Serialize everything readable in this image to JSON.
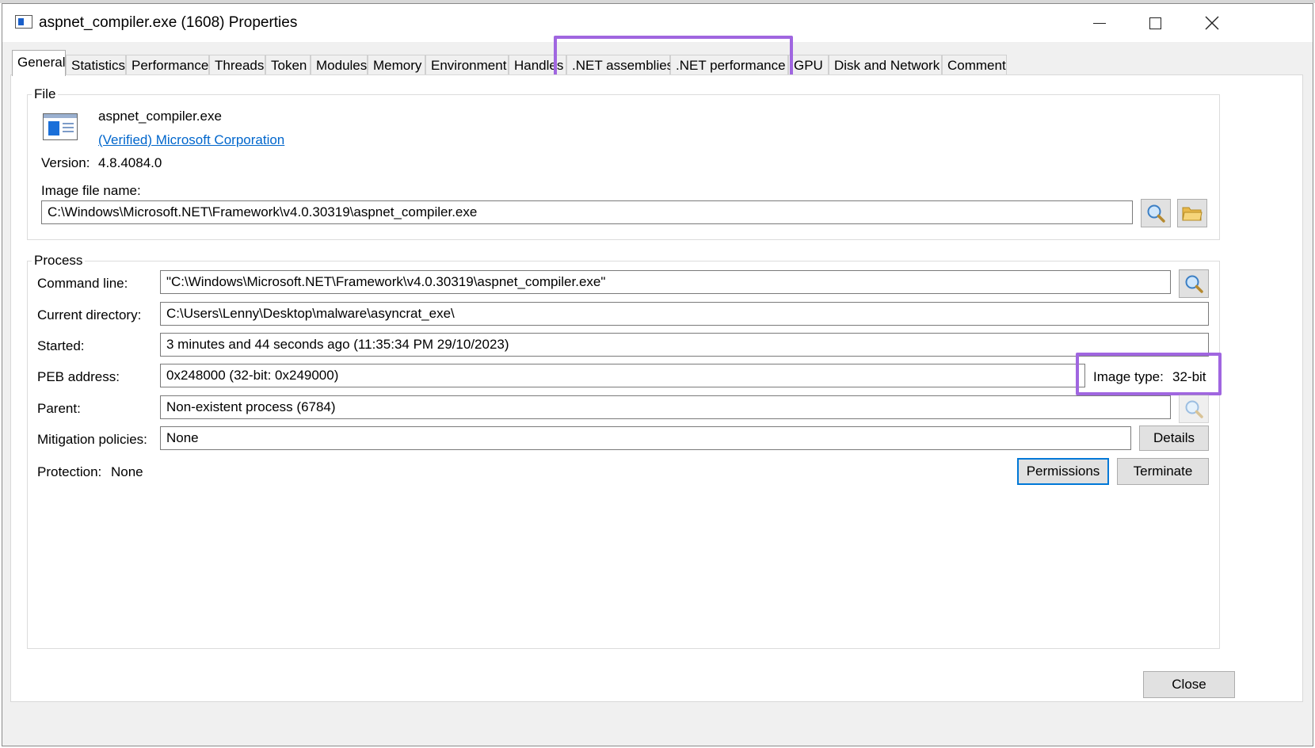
{
  "window": {
    "title": "aspnet_compiler.exe (1608) Properties",
    "controls": {
      "minimize": "—",
      "maximize": "☐",
      "close": "✕"
    }
  },
  "tabs": [
    {
      "label": "General",
      "active": true
    },
    {
      "label": "Statistics"
    },
    {
      "label": "Performance"
    },
    {
      "label": "Threads"
    },
    {
      "label": "Token"
    },
    {
      "label": "Modules"
    },
    {
      "label": "Memory"
    },
    {
      "label": "Environment"
    },
    {
      "label": "Handles"
    },
    {
      "label": ".NET assemblies"
    },
    {
      "label": ".NET performance"
    },
    {
      "label": "GPU"
    },
    {
      "label": "Disk and Network"
    },
    {
      "label": "Comment"
    }
  ],
  "file": {
    "legend": "File",
    "name": "aspnet_compiler.exe",
    "publisher": "(Verified) Microsoft Corporation",
    "version_label": "Version:",
    "version": "4.8.4084.0",
    "image_file_name_label": "Image file name:",
    "image_file_name": "C:\\Windows\\Microsoft.NET\\Framework\\v4.0.30319\\aspnet_compiler.exe"
  },
  "process": {
    "legend": "Process",
    "command_line_label": "Command line:",
    "command_line": "\"C:\\Windows\\Microsoft.NET\\Framework\\v4.0.30319\\aspnet_compiler.exe\"",
    "current_directory_label": "Current directory:",
    "current_directory": "C:\\Users\\Lenny\\Desktop\\malware\\asyncrat_exe\\",
    "started_label": "Started:",
    "started": "3 minutes and 44 seconds ago (11:35:34 PM 29/10/2023)",
    "peb_label": "PEB address:",
    "peb": "0x248000 (32-bit: 0x249000)",
    "image_type_label": "Image type:",
    "image_type": "32-bit",
    "parent_label": "Parent:",
    "parent": "Non-existent process (6784)",
    "mitigation_label": "Mitigation policies:",
    "mitigation": "None",
    "details_button": "Details",
    "protection_label": "Protection:",
    "protection": "None",
    "permissions_button": "Permissions",
    "terminate_button": "Terminate"
  },
  "footer": {
    "close_button": "Close"
  },
  "colors": {
    "highlight": "#a066e0",
    "link": "#0066cc",
    "focus": "#0078d7"
  },
  "icons": [
    "app-window-icon",
    "file-exe-icon",
    "magnifier-icon",
    "folder-icon"
  ]
}
